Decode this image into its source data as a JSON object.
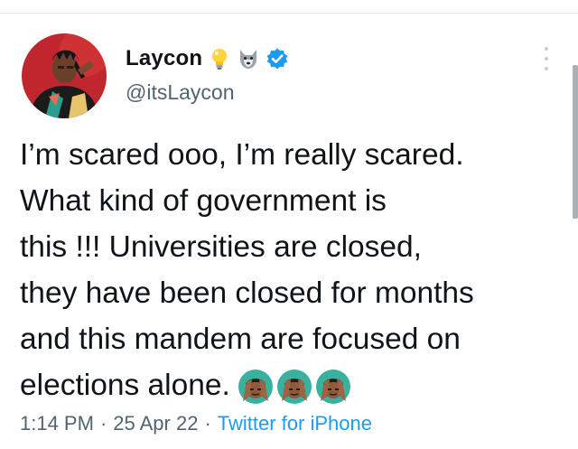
{
  "user": {
    "display_name": "Laycon",
    "handle": "@itsLaycon",
    "badges": [
      "lightbulb-icon",
      "wolf-icon",
      "verified-badge-icon"
    ],
    "verified_color": "#1d9bf0"
  },
  "tweet": {
    "text": "I’m scared ooo, I’m really scared.\nWhat kind of government is\nthis !!! Universities are closed,\nthey have been closed for months\nand this mandem are focused on\nelections alone.",
    "emoji": [
      "face-palm-emoji",
      "face-palm-emoji",
      "face-palm-emoji"
    ]
  },
  "meta": {
    "time": "1:14 PM",
    "separator": "·",
    "date": "25 Apr 22",
    "source": "Twitter for iPhone"
  },
  "colors": {
    "text": "#0f1419",
    "secondary": "#536471",
    "link": "#1d9bf0"
  }
}
